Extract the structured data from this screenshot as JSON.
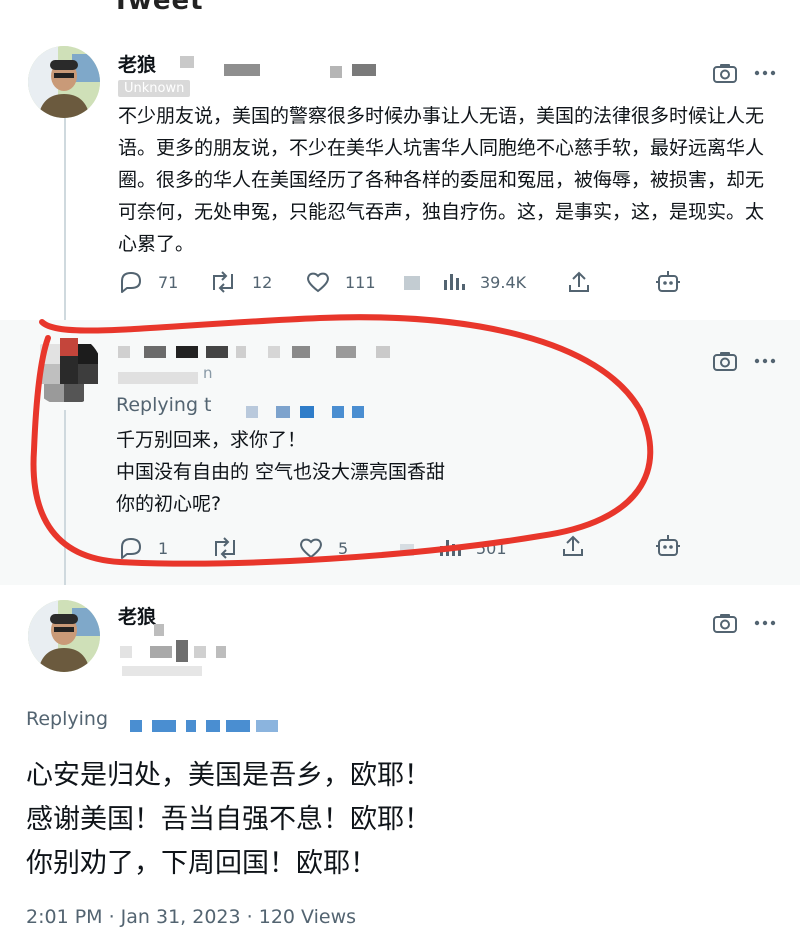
{
  "top_cut_text": "Tweet",
  "tweet1": {
    "author": "老狼",
    "badge": "Unknown",
    "text": "不少朋友说，美国的警察很多时候办事让人无语，美国的法律很多时候让人无语。更多的朋友说，不少在美华人坑害华人同胞绝不心慈手软，最好远离华人圈。很多的华人在美国经历了各种各样的委屈和冤屈，被侮辱，被损害，却无可奈何，无处申冤，只能忍气吞声，独自疗伤。这，是事实，这，是现实。太心累了。",
    "replies": "71",
    "retweets": "12",
    "likes": "111",
    "views": "39.4K"
  },
  "tweet2": {
    "handle_suffix": "n",
    "replying": "Replying t",
    "lines": [
      "千万别回来，求你了！",
      "中国没有自由的 空气也没大漂亮国香甜",
      "你的初心呢?"
    ],
    "replies": "1",
    "likes": "5",
    "views": "501"
  },
  "tweet3": {
    "author": "老狼",
    "replying": "Replying",
    "lines": [
      "心安是归处，美国是吾乡，欧耶！",
      "感谢美国！吾当自强不息！欧耶！",
      "你别劝了，下周回国！欧耶！"
    ],
    "meta": "2:01 PM · Jan 31, 2023 · 120 Views"
  },
  "colors": {
    "annotation_red": "#e8362b",
    "muted_gray": "#536471",
    "panel_bg": "#f7f9f9"
  }
}
